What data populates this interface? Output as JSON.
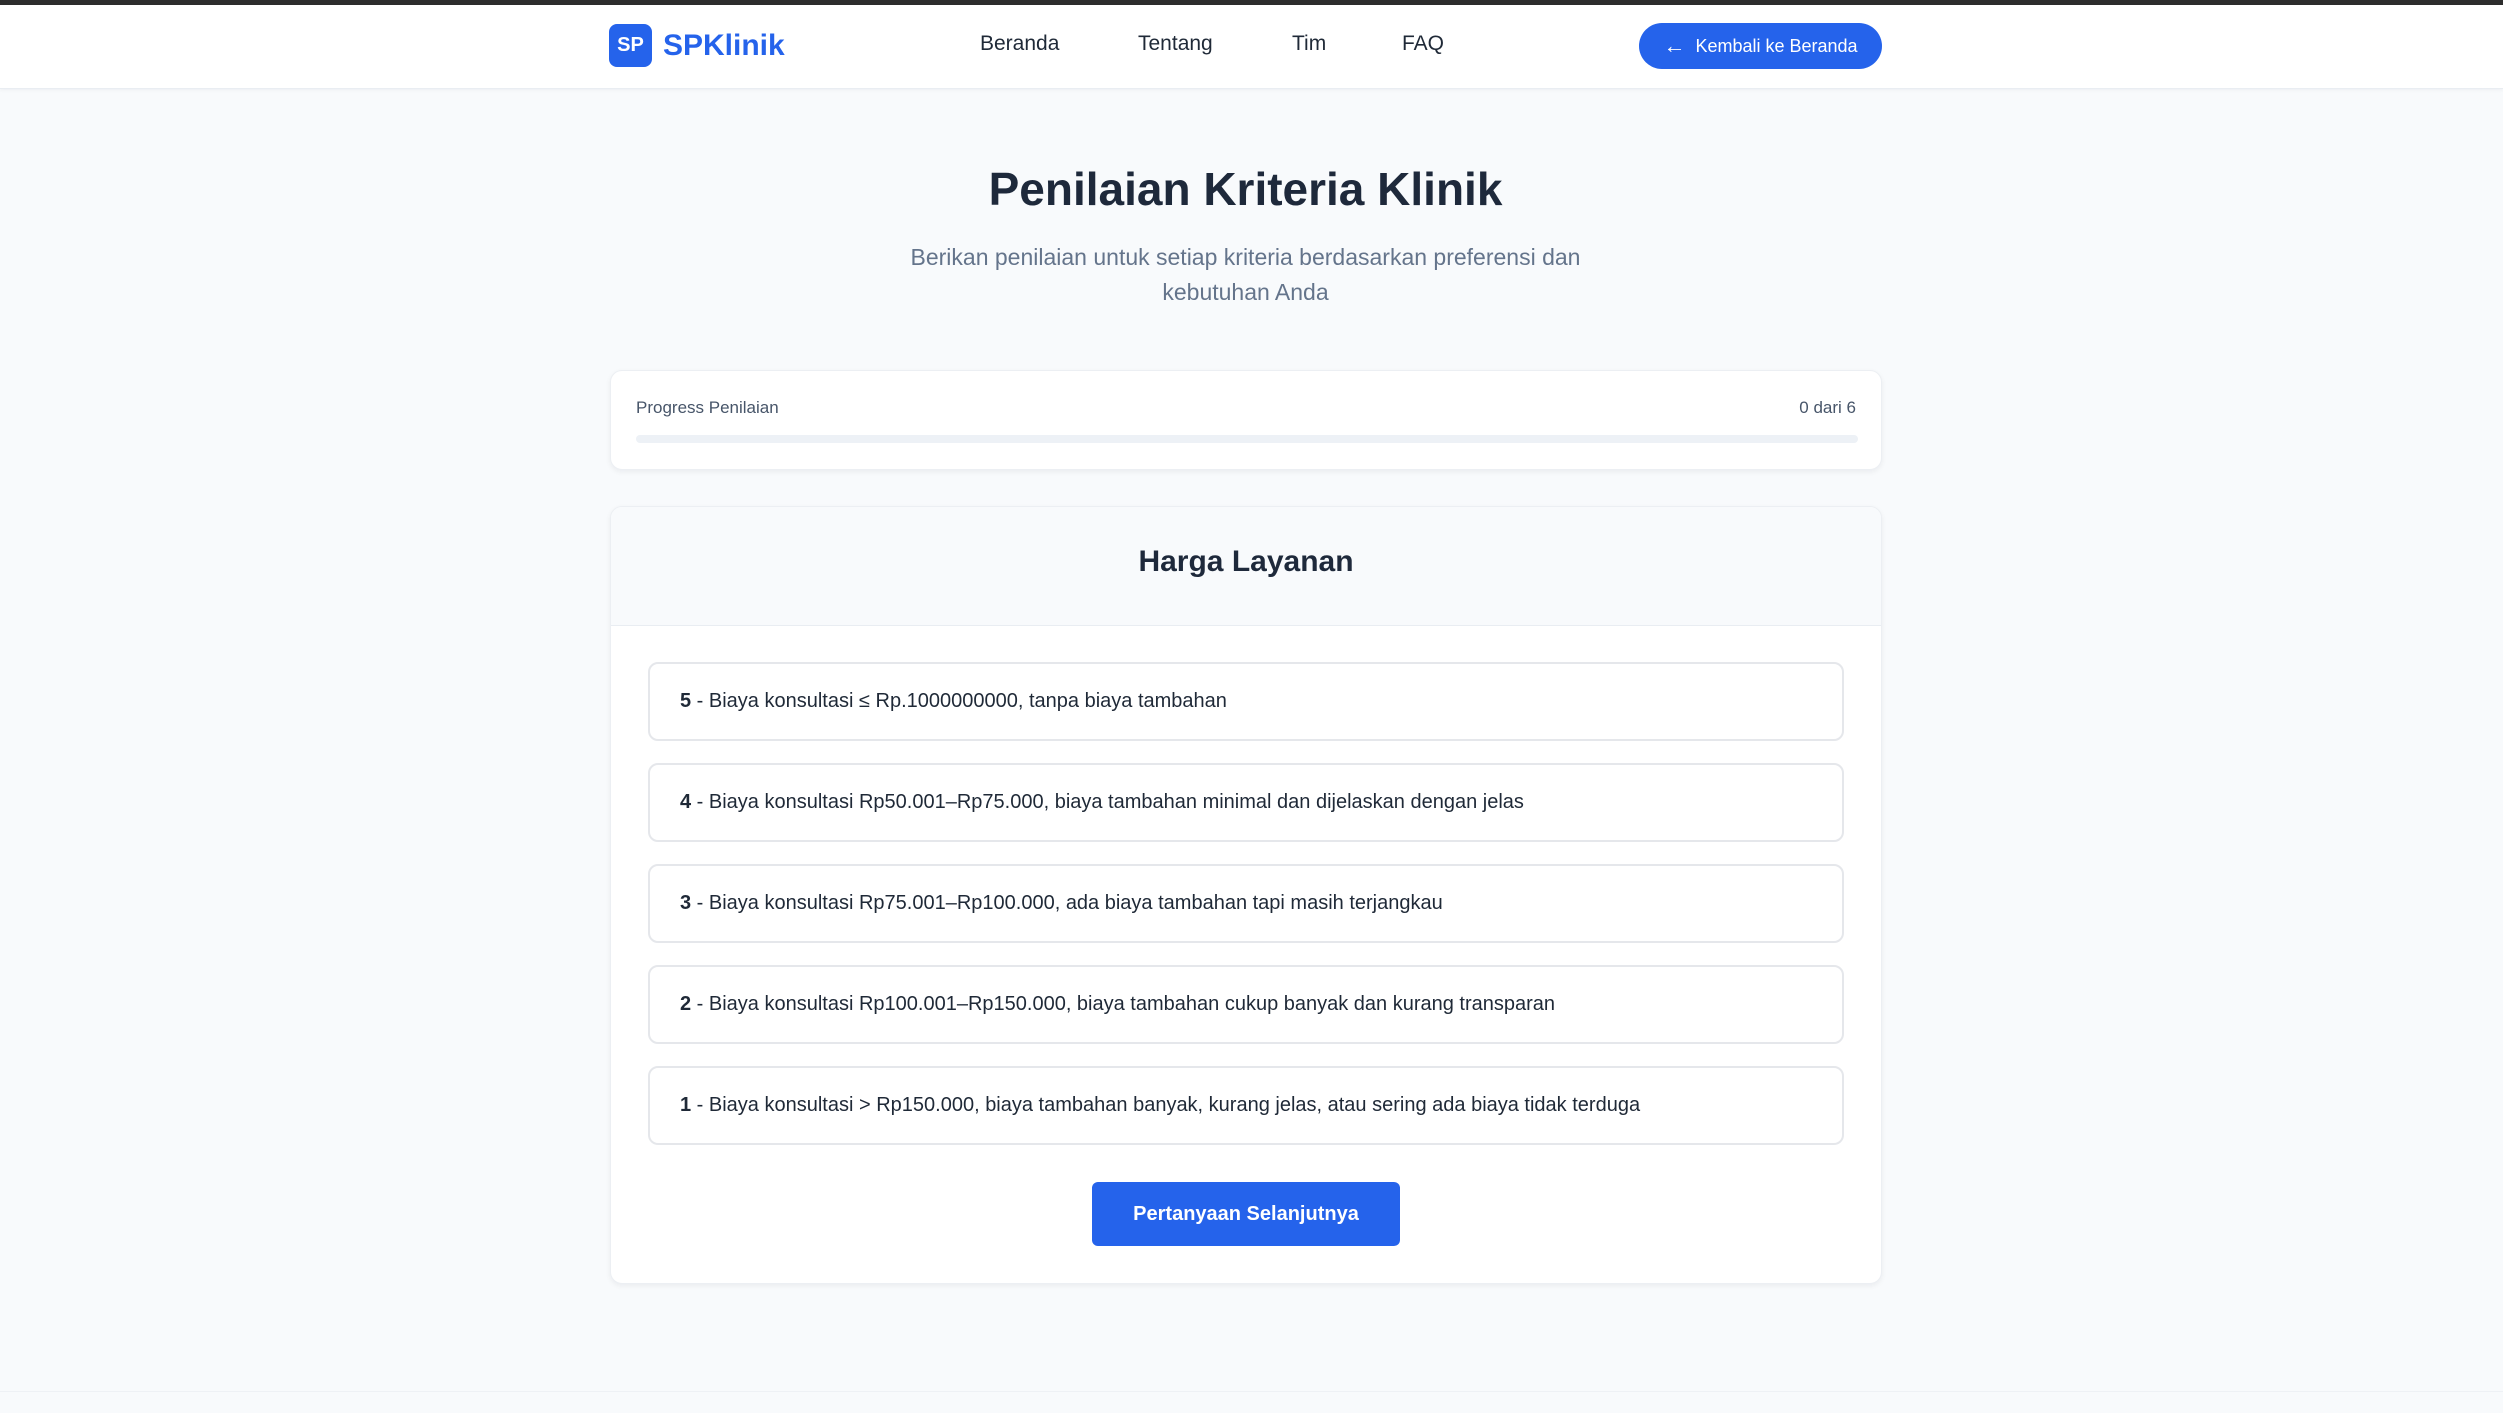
{
  "brand": {
    "badge": "SP",
    "name": "SPKlinik"
  },
  "nav": {
    "items": [
      "Beranda",
      "Tentang",
      "Tim",
      "FAQ"
    ],
    "back_label": "Kembali ke Beranda",
    "back_icon": "arrow-left-icon"
  },
  "page": {
    "title": "Penilaian Kriteria Klinik",
    "subtitle": "Berikan penilaian untuk setiap kriteria berdasarkan preferensi dan kebutuhan Anda"
  },
  "progress": {
    "label": "Progress Penilaian",
    "count_text": "0 dari 6",
    "completed": 0,
    "total": 6
  },
  "question": {
    "title": "Harga Layanan",
    "options": [
      {
        "score": "5",
        "text": " - Biaya konsultasi ≤ Rp.1000000000, tanpa biaya tambahan"
      },
      {
        "score": "4",
        "text": " - Biaya konsultasi Rp50.001–Rp75.000, biaya tambahan minimal dan dijelaskan dengan jelas"
      },
      {
        "score": "3",
        "text": " - Biaya konsultasi Rp75.001–Rp100.000, ada biaya tambahan tapi masih terjangkau"
      },
      {
        "score": "2",
        "text": " - Biaya konsultasi Rp100.001–Rp150.000, biaya tambahan cukup banyak dan kurang transparan"
      },
      {
        "score": "1",
        "text": " - Biaya konsultasi > Rp150.000, biaya tambahan banyak, kurang jelas, atau sering ada biaya tidak terduga"
      }
    ],
    "next_label": "Pertanyaan Selanjutnya"
  },
  "colors": {
    "accent": "#2563eb",
    "text": "#1e293b",
    "muted": "#64748b",
    "background": "#f8fafc"
  }
}
